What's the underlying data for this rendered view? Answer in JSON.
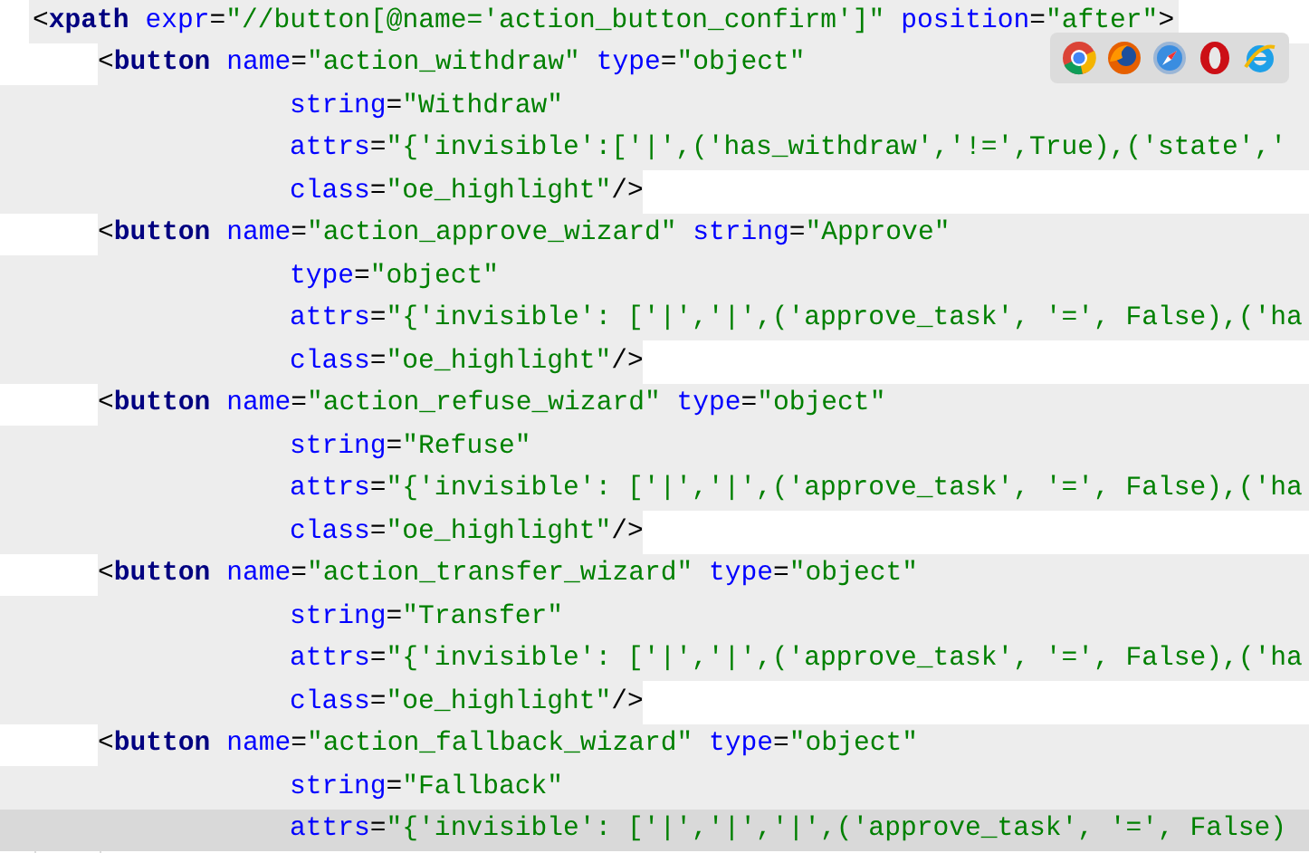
{
  "browser_icons": [
    {
      "kind": "chrome"
    },
    {
      "kind": "firefox"
    },
    {
      "kind": "safari"
    },
    {
      "kind": "opera"
    },
    {
      "kind": "ie"
    }
  ],
  "lines": [
    {
      "kind": "root",
      "text": "<xpath expr=\"//button[@name='action_button_confirm']\" position=\"after\">"
    },
    {
      "kind": "tag",
      "text": "<button name=\"action_withdraw\" type=\"object\""
    },
    {
      "kind": "attr",
      "text": "string=\"Withdraw\""
    },
    {
      "kind": "attr",
      "text": "attrs=\"{'invisible':['|',('has_withdraw','!=',True),('state','"
    },
    {
      "kind": "attr_end",
      "text": "class=\"oe_highlight\"/>"
    },
    {
      "kind": "tag",
      "text": "<button name=\"action_approve_wizard\" string=\"Approve\""
    },
    {
      "kind": "attr",
      "text": "type=\"object\""
    },
    {
      "kind": "attr",
      "text": "attrs=\"{'invisible': ['|','|',('approve_task', '=', False),('ha"
    },
    {
      "kind": "attr_end",
      "text": "class=\"oe_highlight\"/>"
    },
    {
      "kind": "tag",
      "text": "<button name=\"action_refuse_wizard\" type=\"object\""
    },
    {
      "kind": "attr",
      "text": "string=\"Refuse\""
    },
    {
      "kind": "attr",
      "text": "attrs=\"{'invisible': ['|','|',('approve_task', '=', False),('ha"
    },
    {
      "kind": "attr_end",
      "text": "class=\"oe_highlight\"/>"
    },
    {
      "kind": "tag",
      "text": "<button name=\"action_transfer_wizard\" type=\"object\""
    },
    {
      "kind": "attr",
      "text": "string=\"Transfer\""
    },
    {
      "kind": "attr",
      "text": "attrs=\"{'invisible': ['|','|',('approve_task', '=', False),('ha"
    },
    {
      "kind": "attr_end",
      "text": "class=\"oe_highlight\"/>"
    },
    {
      "kind": "tag",
      "text": "<button name=\"action_fallback_wizard\" type=\"object\""
    },
    {
      "kind": "attr",
      "text": "string=\"Fallback\""
    },
    {
      "kind": "attr",
      "text": "attrs=\"{'invisible': ['|','|','|',('approve_task', '=', False)",
      "current": true
    }
  ]
}
